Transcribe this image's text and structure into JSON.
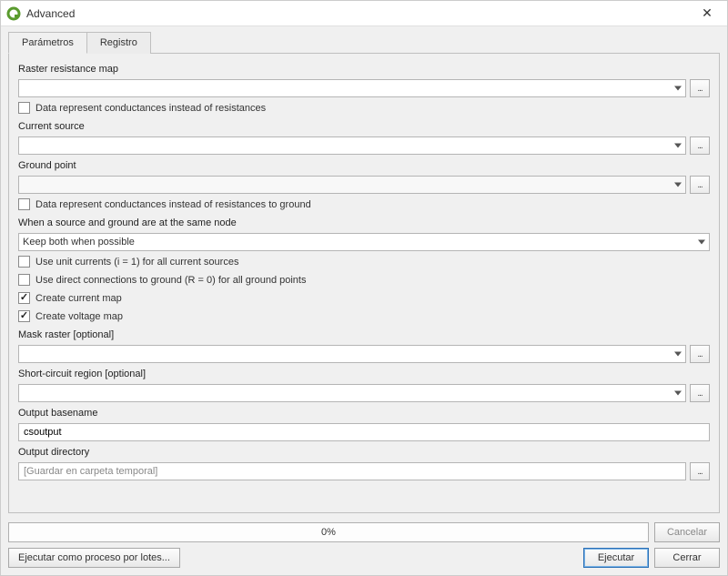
{
  "window": {
    "title": "Advanced"
  },
  "tabs": {
    "parametros": "Parámetros",
    "registro": "Registro"
  },
  "labels": {
    "raster_resistance": "Raster resistance map",
    "chk_conductances": "Data represent conductances instead of resistances",
    "current_source": "Current source",
    "ground_point": "Ground point",
    "chk_conductances_ground": "Data represent conductances instead of resistances to ground",
    "same_node": "When a source and ground are at the same node",
    "same_node_value": "Keep both when possible",
    "chk_unit_currents": "Use unit currents (i = 1) for all current sources",
    "chk_direct_ground": "Use direct connections to ground (R = 0) for all ground points",
    "chk_current_map": "Create current map",
    "chk_voltage_map": "Create voltage map",
    "mask_raster": "Mask raster [optional]",
    "short_circuit": "Short-circuit region [optional]",
    "output_basename": "Output basename",
    "output_basename_value": "csoutput",
    "output_directory": "Output directory",
    "output_directory_placeholder": "[Guardar en carpeta temporal]"
  },
  "progress": {
    "text": "0%"
  },
  "buttons": {
    "cancelar": "Cancelar",
    "batch": "Ejecutar como proceso por lotes...",
    "ejecutar": "Ejecutar",
    "cerrar": "Cerrar",
    "browse": "..."
  }
}
